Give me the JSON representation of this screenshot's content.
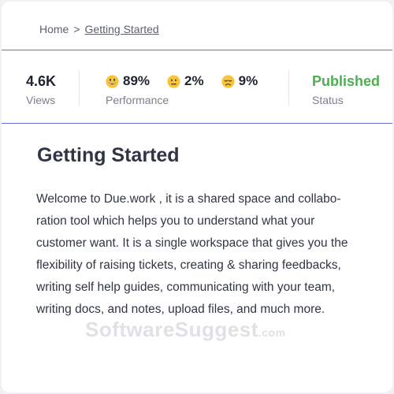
{
  "breadcrumb": {
    "home": "Home",
    "separator": ">",
    "current": "Getting Started"
  },
  "stats": {
    "views": {
      "value": "4.6K",
      "label": "Views"
    },
    "performance": {
      "label": "Performance",
      "items": [
        {
          "icon": "grinning-face-icon",
          "value": "89%"
        },
        {
          "icon": "neutral-face-icon",
          "value": "2%"
        },
        {
          "icon": "pensive-face-icon",
          "value": "9%"
        }
      ]
    },
    "status": {
      "value": "Published",
      "label": "Status"
    }
  },
  "article": {
    "title": "Getting Started",
    "body": "Welcome to Due.work , it is a shared space and collabo-ration tool which helps you to understand what your customer want. It is a single workspace that gives you the flexibility of raising tickets, creating & sharing feedbacks, writing self help guides, communicating with your team, writing docs, and notes,  upload files, and much more."
  },
  "watermark": {
    "text": "SoftwareSuggest",
    "suffix": ".com"
  },
  "colors": {
    "accent": "#6d6bd6",
    "status_published": "#4caf50",
    "emoji_yellow": "#f7c43a"
  }
}
